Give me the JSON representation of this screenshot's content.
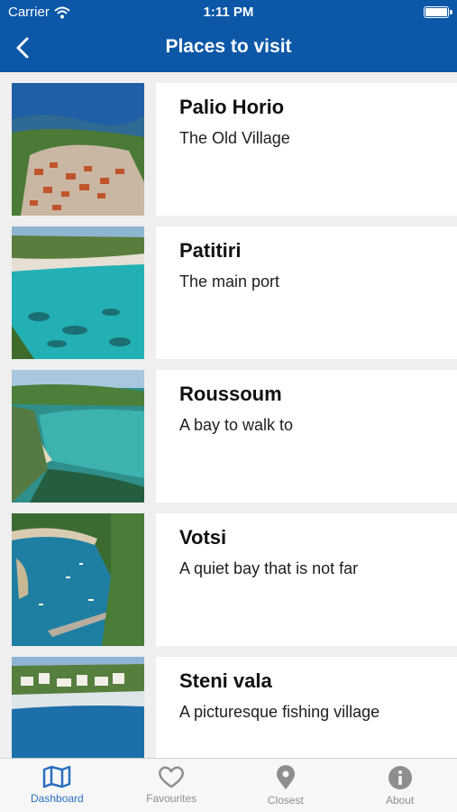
{
  "status_bar": {
    "carrier": "Carrier",
    "time": "1:11 PM"
  },
  "nav": {
    "title": "Places to visit",
    "back_icon": "chevron-left-icon"
  },
  "places": [
    {
      "name": "Palio Horio",
      "description": "The Old Village"
    },
    {
      "name": "Patitiri",
      "description": "The main port"
    },
    {
      "name": "Roussoum",
      "description": "A bay to walk to"
    },
    {
      "name": "Votsi",
      "description": "A quiet bay that is not far"
    },
    {
      "name": "Steni vala",
      "description": "A picturesque fishing village"
    }
  ],
  "tabs": [
    {
      "label": "Dashboard",
      "icon": "map-icon",
      "active": true
    },
    {
      "label": "Favourites",
      "icon": "heart-icon",
      "active": false
    },
    {
      "label": "Closest",
      "icon": "location-pin-icon",
      "active": false
    },
    {
      "label": "About",
      "icon": "info-icon",
      "active": false
    }
  ],
  "colors": {
    "nav_blue": "#0c57a8",
    "active_tab": "#2a6fc0",
    "inactive_tab": "#8e8e8e"
  }
}
